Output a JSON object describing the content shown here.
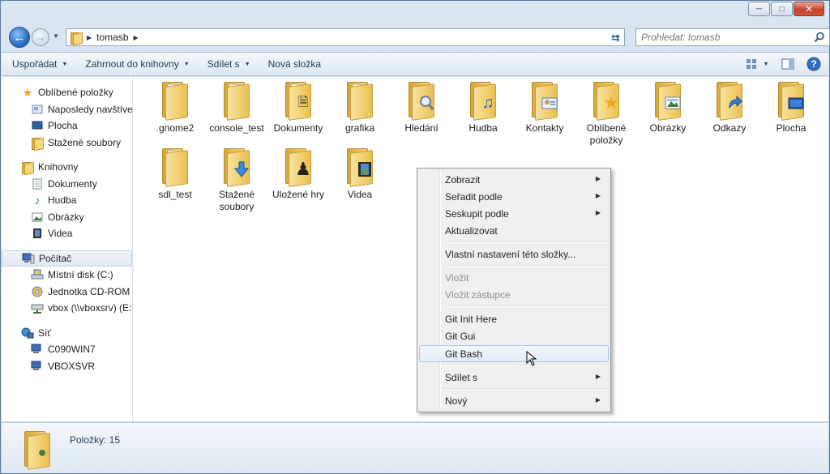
{
  "window": {
    "minimize_glyph": "─",
    "maximize_glyph": "□",
    "close_glyph": "✕"
  },
  "address": {
    "breadcrumb": [
      "tomasb"
    ],
    "search_placeholder": "Prohledat: tomasb"
  },
  "toolbar": {
    "organize": "Uspořádat",
    "include_library": "Zahrnout do knihovny",
    "share": "Sdílet s",
    "new_folder": "Nová složka"
  },
  "nav": {
    "favorites": {
      "label": "Oblíbené položky",
      "items": [
        "Naposledy navštívené",
        "Plocha",
        "Stažené soubory"
      ]
    },
    "libraries": {
      "label": "Knihovny",
      "items": [
        "Dokumenty",
        "Hudba",
        "Obrázky",
        "Videa"
      ]
    },
    "computer": {
      "label": "Počítač",
      "items": [
        "Místní disk (C:)",
        "Jednotka CD-ROM (D:)",
        "vbox (\\\\vboxsrv) (E:)"
      ]
    },
    "network": {
      "label": "Síť",
      "items": [
        "C090WIN7",
        "VBOXSVR"
      ]
    }
  },
  "files": [
    {
      "name": ".gnome2",
      "emblem": "none"
    },
    {
      "name": "console_test",
      "emblem": "none"
    },
    {
      "name": "Dokumenty",
      "emblem": "document-icon"
    },
    {
      "name": "grafika",
      "emblem": "none"
    },
    {
      "name": "Hledání",
      "emblem": "magnifier-icon"
    },
    {
      "name": "Hudba",
      "emblem": "music-note-icon"
    },
    {
      "name": "Kontakty",
      "emblem": "contact-card-icon"
    },
    {
      "name": "Oblíbené položky",
      "emblem": "star-icon"
    },
    {
      "name": "Obrázky",
      "emblem": "picture-icon"
    },
    {
      "name": "Odkazy",
      "emblem": "arrow-link-icon"
    },
    {
      "name": "Plocha",
      "emblem": "desktop-icon"
    },
    {
      "name": "sdl_test",
      "emblem": "none"
    },
    {
      "name": "Stažené soubory",
      "emblem": "download-arrow-icon"
    },
    {
      "name": "Uložené hry",
      "emblem": "chess-piece-icon"
    },
    {
      "name": "Videa",
      "emblem": "film-strip-icon"
    }
  ],
  "status": {
    "item_count": "Položky: 15"
  },
  "context_menu": {
    "items": [
      {
        "label": "Zobrazit",
        "submenu": true
      },
      {
        "label": "Seřadit podle",
        "submenu": true
      },
      {
        "label": "Seskupit podle",
        "submenu": true
      },
      {
        "label": "Aktualizovat"
      },
      {
        "label": "Vlastní nastavení této složky..."
      },
      {
        "label": "Vložit",
        "disabled": true
      },
      {
        "label": "Vložit zástupce",
        "disabled": true
      },
      {
        "label": "Git Init Here"
      },
      {
        "label": "Git Gui"
      },
      {
        "label": "Git Bash",
        "highlighted": true
      },
      {
        "label": "Sdílet s",
        "submenu": true
      },
      {
        "label": "Nový",
        "submenu": true
      }
    ]
  },
  "colors": {
    "accent": "#2d6ec4",
    "folder": "#f2cf6c",
    "toolbar_text": "#1e395b",
    "menu_highlight_border": "#a8c4ea"
  }
}
